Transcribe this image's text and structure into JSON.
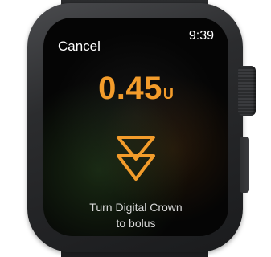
{
  "header": {
    "cancel_label": "Cancel",
    "time": "9:39"
  },
  "bolus": {
    "amount": "0.45",
    "unit": "U",
    "accent_color": "#f39c2b"
  },
  "icons": {
    "bolus_icon": "double-chevron-down-icon"
  },
  "instruction": {
    "line1": "Turn Digital Crown",
    "line2": "to bolus"
  }
}
